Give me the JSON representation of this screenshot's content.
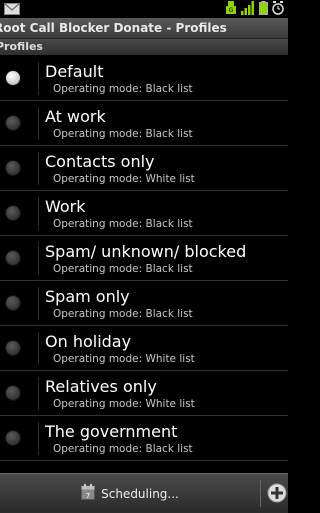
{
  "status": {
    "icons": [
      "usb-icon",
      "signal-icon",
      "battery-icon",
      "alarm-icon"
    ]
  },
  "title": "Root Call Blocker Donate - Profiles",
  "section_header": "Profiles",
  "profiles": [
    {
      "name": "Default",
      "mode": "Operating mode: Black list",
      "selected": true
    },
    {
      "name": "At work",
      "mode": "Operating mode: Black list",
      "selected": false
    },
    {
      "name": "Contacts only",
      "mode": "Operating mode: White list",
      "selected": false
    },
    {
      "name": "Work",
      "mode": "Operating mode: Black list",
      "selected": false
    },
    {
      "name": "Spam/ unknown/ blocked",
      "mode": "Operating mode: Black list",
      "selected": false
    },
    {
      "name": "Spam only",
      "mode": "Operating mode: Black list",
      "selected": false
    },
    {
      "name": "On holiday",
      "mode": "Operating mode: White list",
      "selected": false
    },
    {
      "name": "Relatives only",
      "mode": "Operating mode: White list",
      "selected": false
    },
    {
      "name": "The government",
      "mode": "Operating mode: Black list",
      "selected": false
    }
  ],
  "bottom": {
    "scheduling_label": "Scheduling..."
  },
  "colors": {
    "signal": "#8fd400",
    "background": "#000000"
  }
}
